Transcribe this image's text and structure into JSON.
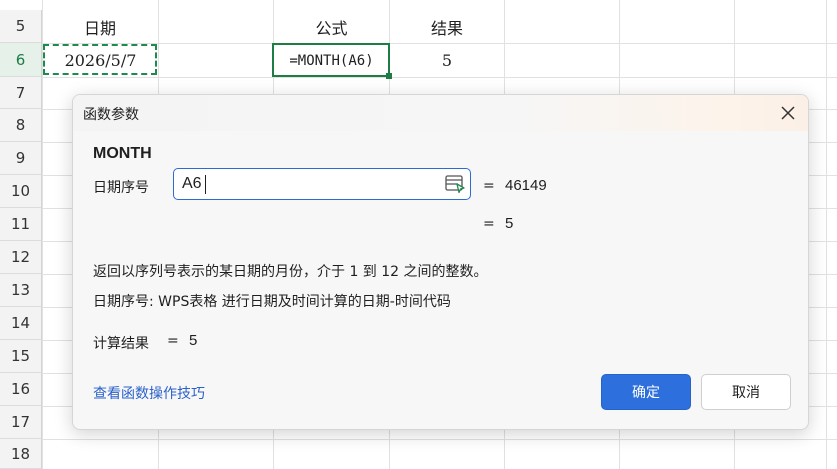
{
  "sheet": {
    "rows": [
      "5",
      "6",
      "7",
      "8",
      "9",
      "10",
      "11",
      "12",
      "13",
      "14",
      "15",
      "16",
      "17",
      "18"
    ],
    "active_row": "6",
    "header_cells": {
      "date_label": "日期",
      "formula_label": "公式",
      "result_label": "结果"
    },
    "row6": {
      "date_value": "2026/5/7",
      "formula": "=MONTH(A6)",
      "result": "5"
    },
    "colors": {
      "accent": "#1e7d45",
      "grid": "#e1e1e1"
    }
  },
  "dialog": {
    "title": "函数参数",
    "close_icon": "close-icon",
    "function_name": "MONTH",
    "argument": {
      "label": "日期序号",
      "value": "A6",
      "ref_icon": "range-select-icon",
      "equals": "=",
      "evaluated": "46149"
    },
    "result_preview": {
      "equals": "=",
      "value": "5"
    },
    "description": "返回以序列号表示的某日期的月份，介于 1 到 12 之间的整数。",
    "argument_help": "日期序号:  WPS表格 进行日期及时间计算的日期-时间代码",
    "calc_result": {
      "label": "计算结果",
      "equals": "=",
      "value": "5"
    },
    "help_link": "查看函数操作技巧",
    "ok_label": "确定",
    "cancel_label": "取消",
    "colors": {
      "primary": "#2d6fdc",
      "link": "#2b62c8"
    }
  }
}
